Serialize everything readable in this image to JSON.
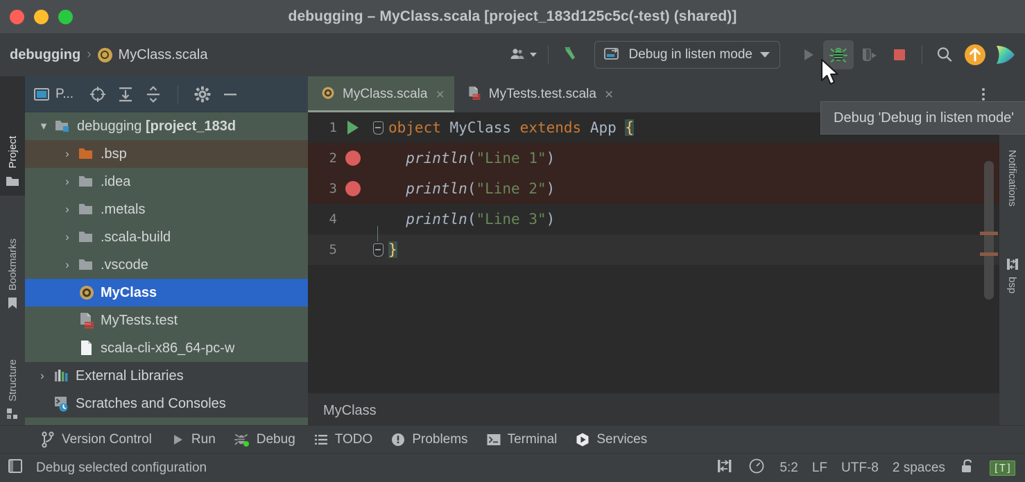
{
  "window": {
    "title": "debugging – MyClass.scala [project_183d125c5c(-test) (shared)]",
    "controls": [
      "close",
      "minimize",
      "maximize"
    ]
  },
  "toolbar": {
    "breadcrumb": {
      "project": "debugging",
      "separator": "›",
      "file": "MyClass.scala"
    },
    "account_icon": "user-icon",
    "build_icon": "hammer-icon",
    "run_config": {
      "label": "Debug in listen mode",
      "icon": "remote-debug-icon"
    },
    "actions": [
      {
        "name": "run-button",
        "icon": "play-icon",
        "state": "disabled"
      },
      {
        "name": "debug-button",
        "icon": "bug-icon",
        "state": "hovered"
      },
      {
        "name": "run-with-coverage-button",
        "icon": "coverage-icon",
        "state": "disabled"
      },
      {
        "name": "stop-button",
        "icon": "stop-square-icon",
        "state": "enabled"
      },
      {
        "name": "search-everywhere-button",
        "icon": "search-icon",
        "state": "enabled"
      },
      {
        "name": "update-project-button",
        "icon": "orange-arrow-up-icon",
        "state": "enabled"
      },
      {
        "name": "ai-assistant-button",
        "icon": "ai-gradient-icon",
        "state": "enabled"
      }
    ]
  },
  "tooltip": {
    "text": "Debug 'Debug in listen mode'"
  },
  "left_stripe": [
    {
      "label": "Project",
      "icon": "folder-icon",
      "selected": true
    },
    {
      "label": "Bookmarks",
      "icon": "bookmark-icon",
      "selected": false
    },
    {
      "label": "Structure",
      "icon": "structure-icon",
      "selected": false
    }
  ],
  "right_stripe": [
    {
      "label": "Notifications",
      "icon": "notifications-icon"
    },
    {
      "label": "bsp",
      "icon": "bsp-icon"
    }
  ],
  "project_panel": {
    "header": {
      "title": "P...",
      "icons": [
        "select-opened-file-icon",
        "expand-all-icon",
        "collapse-all-icon",
        "settings-gear-icon",
        "hide-minus-icon"
      ]
    },
    "tree": [
      {
        "label": "debugging [project_183d",
        "bold_from": 10,
        "icon": "module-folder-icon",
        "arrow": "expanded",
        "depth": 0,
        "state": "root"
      },
      {
        "label": ".bsp",
        "icon": "folder-orange-icon",
        "arrow": "collapsed",
        "depth": 1,
        "state": "hover"
      },
      {
        "label": ".idea",
        "icon": "folder-icon",
        "arrow": "collapsed",
        "depth": 1,
        "state": "normal"
      },
      {
        "label": ".metals",
        "icon": "folder-icon",
        "arrow": "collapsed",
        "depth": 1,
        "state": "normal"
      },
      {
        "label": ".scala-build",
        "icon": "folder-icon",
        "arrow": "collapsed",
        "depth": 1,
        "state": "normal"
      },
      {
        "label": ".vscode",
        "icon": "folder-icon",
        "arrow": "collapsed",
        "depth": 1,
        "state": "normal"
      },
      {
        "label": "MyClass",
        "icon": "scala-object-icon",
        "arrow": "none",
        "depth": 1,
        "state": "selected"
      },
      {
        "label": "MyTests.test",
        "icon": "scala-test-icon",
        "arrow": "none",
        "depth": 1,
        "state": "normal"
      },
      {
        "label": "scala-cli-x86_64-pc-w",
        "icon": "file-icon",
        "arrow": "none",
        "depth": 1,
        "state": "normal"
      },
      {
        "label": "External Libraries",
        "icon": "libraries-icon",
        "arrow": "collapsed",
        "depth": 0,
        "state": "plain"
      },
      {
        "label": "Scratches and Consoles",
        "icon": "scratches-icon",
        "arrow": "none",
        "depth": 0,
        "state": "plain"
      }
    ]
  },
  "editor": {
    "tabs": [
      {
        "label": "MyClass.scala",
        "icon": "scala-object-icon",
        "active": true,
        "close": "×"
      },
      {
        "label": "MyTests.test.scala",
        "icon": "scala-test-icon",
        "active": false,
        "close": "×"
      }
    ],
    "more_tabs_icon": "more-vertical-icon",
    "lines": [
      {
        "number": "1",
        "gutter": "run-gutter-icon",
        "fold": "fold-open",
        "row_state": "normal",
        "tokens": [
          {
            "t": "object ",
            "c": "kw"
          },
          {
            "t": "MyClass ",
            "c": "nm"
          },
          {
            "t": "extends ",
            "c": "kw"
          },
          {
            "t": "App ",
            "c": "nm"
          },
          {
            "t": "{",
            "c": "brace-hl"
          }
        ]
      },
      {
        "number": "2",
        "gutter": "breakpoint-icon",
        "fold": "none",
        "row_state": "breakpoint",
        "tokens": [
          {
            "t": "  ",
            "c": "nm"
          },
          {
            "t": "println",
            "c": "fn"
          },
          {
            "t": "(",
            "c": "punct"
          },
          {
            "t": "\"Line 1\"",
            "c": "str"
          },
          {
            "t": ")",
            "c": "punct"
          }
        ]
      },
      {
        "number": "3",
        "gutter": "breakpoint-icon",
        "fold": "none",
        "row_state": "breakpoint",
        "tokens": [
          {
            "t": "  ",
            "c": "nm"
          },
          {
            "t": "println",
            "c": "fn"
          },
          {
            "t": "(",
            "c": "punct"
          },
          {
            "t": "\"Line 2\"",
            "c": "str"
          },
          {
            "t": ")",
            "c": "punct"
          }
        ]
      },
      {
        "number": "4",
        "gutter": "none",
        "fold": "none",
        "row_state": "normal",
        "tokens": [
          {
            "t": "  ",
            "c": "nm"
          },
          {
            "t": "println",
            "c": "fn"
          },
          {
            "t": "(",
            "c": "punct"
          },
          {
            "t": "\"Line 3\"",
            "c": "str"
          },
          {
            "t": ")",
            "c": "punct"
          }
        ]
      },
      {
        "number": "5",
        "gutter": "none",
        "fold": "fold-close",
        "row_state": "cursorline",
        "tokens": [
          {
            "t": "}",
            "c": "brace-hl"
          }
        ]
      }
    ],
    "breadcrumb": "MyClass",
    "scrollbar_marks": 2
  },
  "tool_windows": [
    {
      "label": "Version Control",
      "icon": "branch-icon"
    },
    {
      "label": "Run",
      "icon": "play-icon"
    },
    {
      "label": "Debug",
      "icon": "bug-green-icon"
    },
    {
      "label": "TODO",
      "icon": "list-icon"
    },
    {
      "label": "Problems",
      "icon": "warning-icon"
    },
    {
      "label": "Terminal",
      "icon": "terminal-icon"
    },
    {
      "label": "Services",
      "icon": "services-icon"
    }
  ],
  "status_bar": {
    "left_icon": "toggle-toolwindows-icon",
    "message": "Debug selected configuration",
    "right": {
      "indent_icon": "bsp-reload-icon",
      "clock_icon": "clock-icon",
      "caret": "5:2",
      "line_separator": "LF",
      "encoding": "UTF-8",
      "indent": "2 spaces",
      "lock_icon": "unlocked-icon",
      "typo_badge": "[T]"
    }
  },
  "colors": {
    "accent_blue": "#2a65c8",
    "debug_green": "#59a869",
    "breakpoint_red": "#db5c5c",
    "string_green": "#6a8759",
    "keyword_orange": "#cc7832",
    "panel_green": "#4b5a50",
    "titlebar": "#4a4d4f",
    "editor_bg": "#2b2b2b"
  }
}
